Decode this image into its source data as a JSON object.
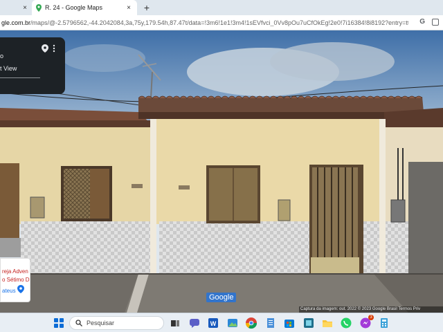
{
  "browser": {
    "prev_tab_close": "×",
    "active_tab_title": "R. 24 - Google Maps",
    "tab_close": "×",
    "new_tab": "+",
    "url_host": "gle.com.br",
    "url_rest": "/maps/@-2.5796562,-44.2042084,3a,75y,179.54h,87.47t/data=!3m6!1e1!3m4!1sEVfvci_0Vv8pOu7uCfOkEg!2e0!7i16384!8i8192?entry=ttu",
    "google_icon_label": "G"
  },
  "info_card": {
    "title": "o",
    "subtitle": "t View"
  },
  "business_card": {
    "line1": "reja Adven",
    "line2": "o Sétimo D",
    "line3": "ateus"
  },
  "map": {
    "google_logo": "Google",
    "credits": "Captura da imagem: out. 2022   © 2023 Google   Brasil   Termos   Priv"
  },
  "taskbar": {
    "search_placeholder": "Pesquisar",
    "whatsapp_badge": "3"
  },
  "colors": {
    "wall": "#ead9a8",
    "roof": "#6b4a3a",
    "sky": "#4d7fb8",
    "tile": "#d8d8d8"
  }
}
